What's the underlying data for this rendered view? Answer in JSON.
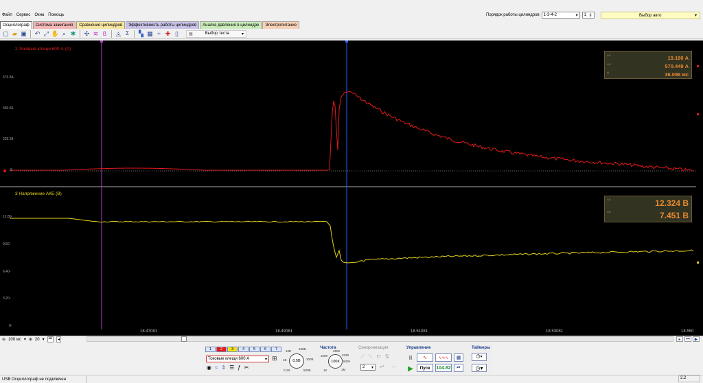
{
  "menu": [
    "Файл",
    "Сервис",
    "Окна",
    "Помощь"
  ],
  "cylinder_order": {
    "label": "Порядок работы цилиндров",
    "value": "1-3-4-2",
    "cylinder": "1"
  },
  "auto_select": {
    "label": "Выбор авто"
  },
  "tabs": [
    {
      "label": "Осциллограф",
      "color": "#ffffff",
      "active": true
    },
    {
      "label": "Система зажигания",
      "color": "#f4b6b6"
    },
    {
      "label": "Сравнение цилиндров",
      "color": "#f6e4a0"
    },
    {
      "label": "Эффективность работы цилиндров",
      "color": "#c9c3e8"
    },
    {
      "label": "Анализ давления в цилиндре",
      "color": "#c8ebb8"
    },
    {
      "label": "Электропитание",
      "color": "#f7d0b6"
    }
  ],
  "toolbar": {
    "icons": [
      "new-icon",
      "open-icon",
      "save-icon",
      "undo-icon",
      "zoom-fit-icon",
      "hand-icon",
      "zoom-icon",
      "crosshair-icon",
      "cursor-icon",
      "split-icon",
      "compare-icon",
      "math-icon",
      "sigma-icon",
      "channel-icon",
      "table-icon",
      "divide-icon",
      "marker-icon",
      "export-icon"
    ],
    "test_select": "Выбор теста"
  },
  "colors": {
    "ch2": "#e51a1a",
    "ch3": "#e6d418",
    "cursor_a": "#b040c0",
    "cursor_b": "#2a62ff",
    "accent": "#e88a30"
  },
  "channel2": {
    "title": "2 Токовые клещи 600 А (А)",
    "yticks": [
      "675.84-",
      "450.56-",
      "225.28-",
      "0-"
    ],
    "measurements": [
      {
        "key": "Δt1",
        "value": "19.180 А"
      },
      {
        "key": "Δt2",
        "value": "570.449 А"
      },
      {
        "key": "dt",
        "value": "36.096 мс"
      }
    ]
  },
  "channel3": {
    "title": "3 Напряжение АКБ (В)",
    "yticks": [
      "12.80-",
      "9.60-",
      "6.40-",
      "3.20-",
      "0-"
    ],
    "measurements": [
      {
        "key": "Δt1",
        "value": "12.324 В"
      },
      {
        "key": "Δt2",
        "value": "7.451 В"
      }
    ]
  },
  "xaxis": {
    "ticks": [
      "18.47081",
      "18.49081",
      "18.51081",
      "18.53081",
      "18.550"
    ]
  },
  "timebase": {
    "value": "100 мс",
    "divs": "20"
  },
  "bottom": {
    "channels": [
      "1",
      "2",
      "3",
      "4",
      "5",
      "6",
      "7"
    ],
    "probe": "Токовые клещи 600 А",
    "frequency_title": "Частота",
    "sync_title": "Синхронизация",
    "control_title": "Управление",
    "timers_title": "Таймеры",
    "amp_knob": {
      "value": "0.5В",
      "labels": [
        "10В",
        "100В",
        "200В",
        "500В",
        "0.1В",
        "1В"
      ]
    },
    "freq_knob": {
      "value": "100К",
      "labels": [
        "250К",
        "333К",
        "500К",
        "100К",
        "1М",
        "1К"
      ]
    },
    "sync_level": "2",
    "start_label": "Пуск",
    "rate_value": "104.82"
  },
  "status": {
    "text": "USB Осциллограф не подключен",
    "right": "2.2"
  }
}
